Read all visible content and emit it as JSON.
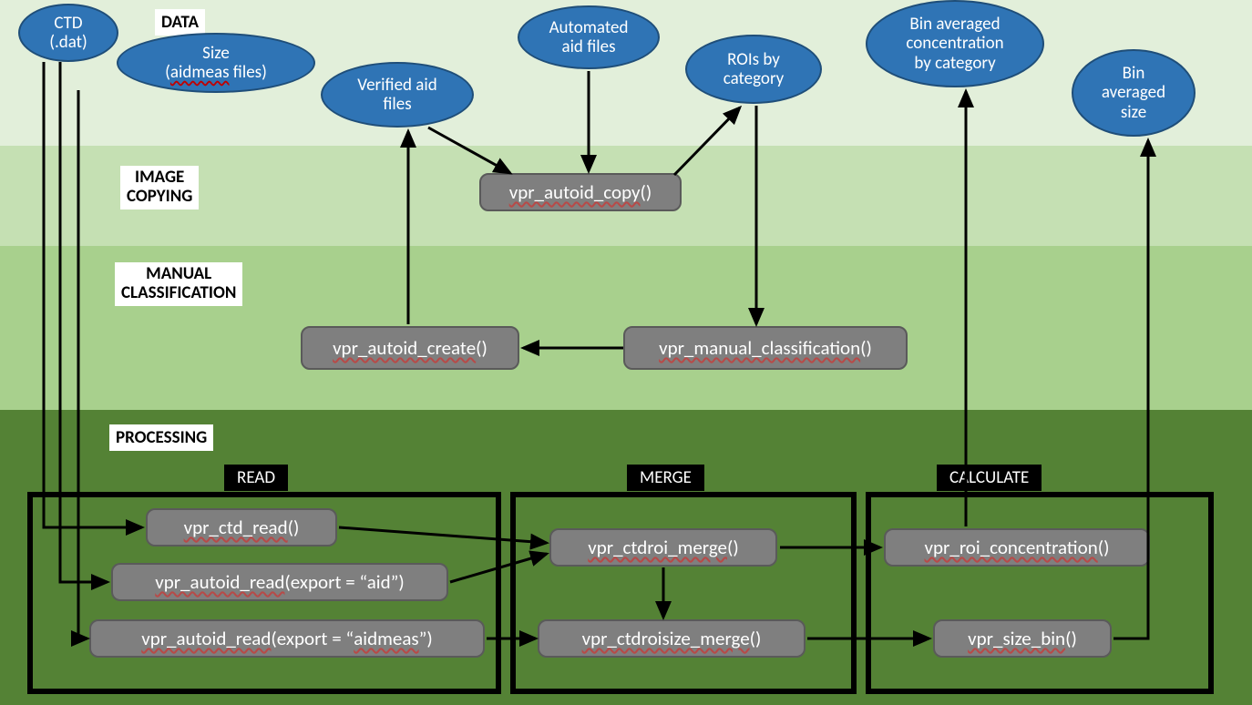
{
  "bands": {
    "data": "DATA",
    "image_copying_l1": "IMAGE",
    "image_copying_l2": "COPYING",
    "manual_l1": "MANUAL",
    "manual_l2": "CLASSIFICATION",
    "processing": "PROCESSING"
  },
  "ellipses": {
    "ctd_l1": "CTD",
    "ctd_l2": "(.dat)",
    "size_l1": "Size",
    "size_l2a": "(",
    "size_l2b": "aidmeas",
    "size_l2c": " files)",
    "verified_l1": "Verified aid",
    "verified_l2": "files",
    "automated_l1": "Automated",
    "automated_l2": "aid files",
    "rois_l1": "ROIs by",
    "rois_l2": "category",
    "binconc_l1": "Bin averaged",
    "binconc_l2": "concentration",
    "binconc_l3": "by category",
    "binsize_l1": "Bin",
    "binsize_l2": "averaged",
    "binsize_l3": "size"
  },
  "fn": {
    "autoid_copy": "vpr_autoid_copy",
    "autoid_create": "vpr_autoid_create",
    "manual_class": "vpr_manual_classification",
    "ctd_read": "vpr_ctd_read",
    "autoid_read": "vpr_autoid_read",
    "autoid_read_aid_suffix": "(export = “aid”)",
    "autoid_read_aidmeas_suffix1": "(export = “",
    "autoid_read_aidmeas_suffix2": "aidmeas",
    "autoid_read_aidmeas_suffix3": "”)",
    "ctdroi_merge": "vpr_ctdroi_merge",
    "ctdroisize_merge": "vpr_ctdroisize_merge",
    "roi_conc": "vpr_roi_concentration",
    "size_bin": "vpr_size_bin",
    "paren": "()"
  },
  "groups": {
    "read": "READ",
    "merge": "MERGE",
    "calculate": "CALCULATE"
  }
}
